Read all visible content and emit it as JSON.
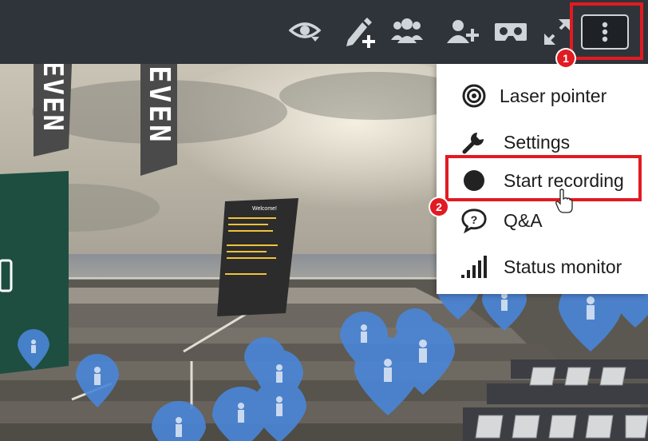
{
  "toolbar": {
    "icons": [
      "eye-icon",
      "edit-add-icon",
      "users-icon",
      "add-user-icon",
      "vr-headset-icon",
      "fullscreen-icon",
      "more-vertical-icon"
    ]
  },
  "annotations": {
    "step1": "1",
    "step2": "2"
  },
  "menu": {
    "items": [
      {
        "label": "Laser pointer",
        "icon": "laser-target-icon"
      },
      {
        "label": "Settings",
        "icon": "wrench-icon"
      },
      {
        "label": "Start recording",
        "icon": "record-dot-icon"
      },
      {
        "label": "Q&A",
        "icon": "question-bubble-icon"
      },
      {
        "label": "Status monitor",
        "icon": "signal-bars-icon"
      }
    ]
  },
  "scene": {
    "banner_text": "EVEN",
    "welcome_title": "Welcome!"
  },
  "colors": {
    "toolbar_bg": "#2f343a",
    "highlight": "#e21a22",
    "avatar_pin": "#4a86d8"
  }
}
